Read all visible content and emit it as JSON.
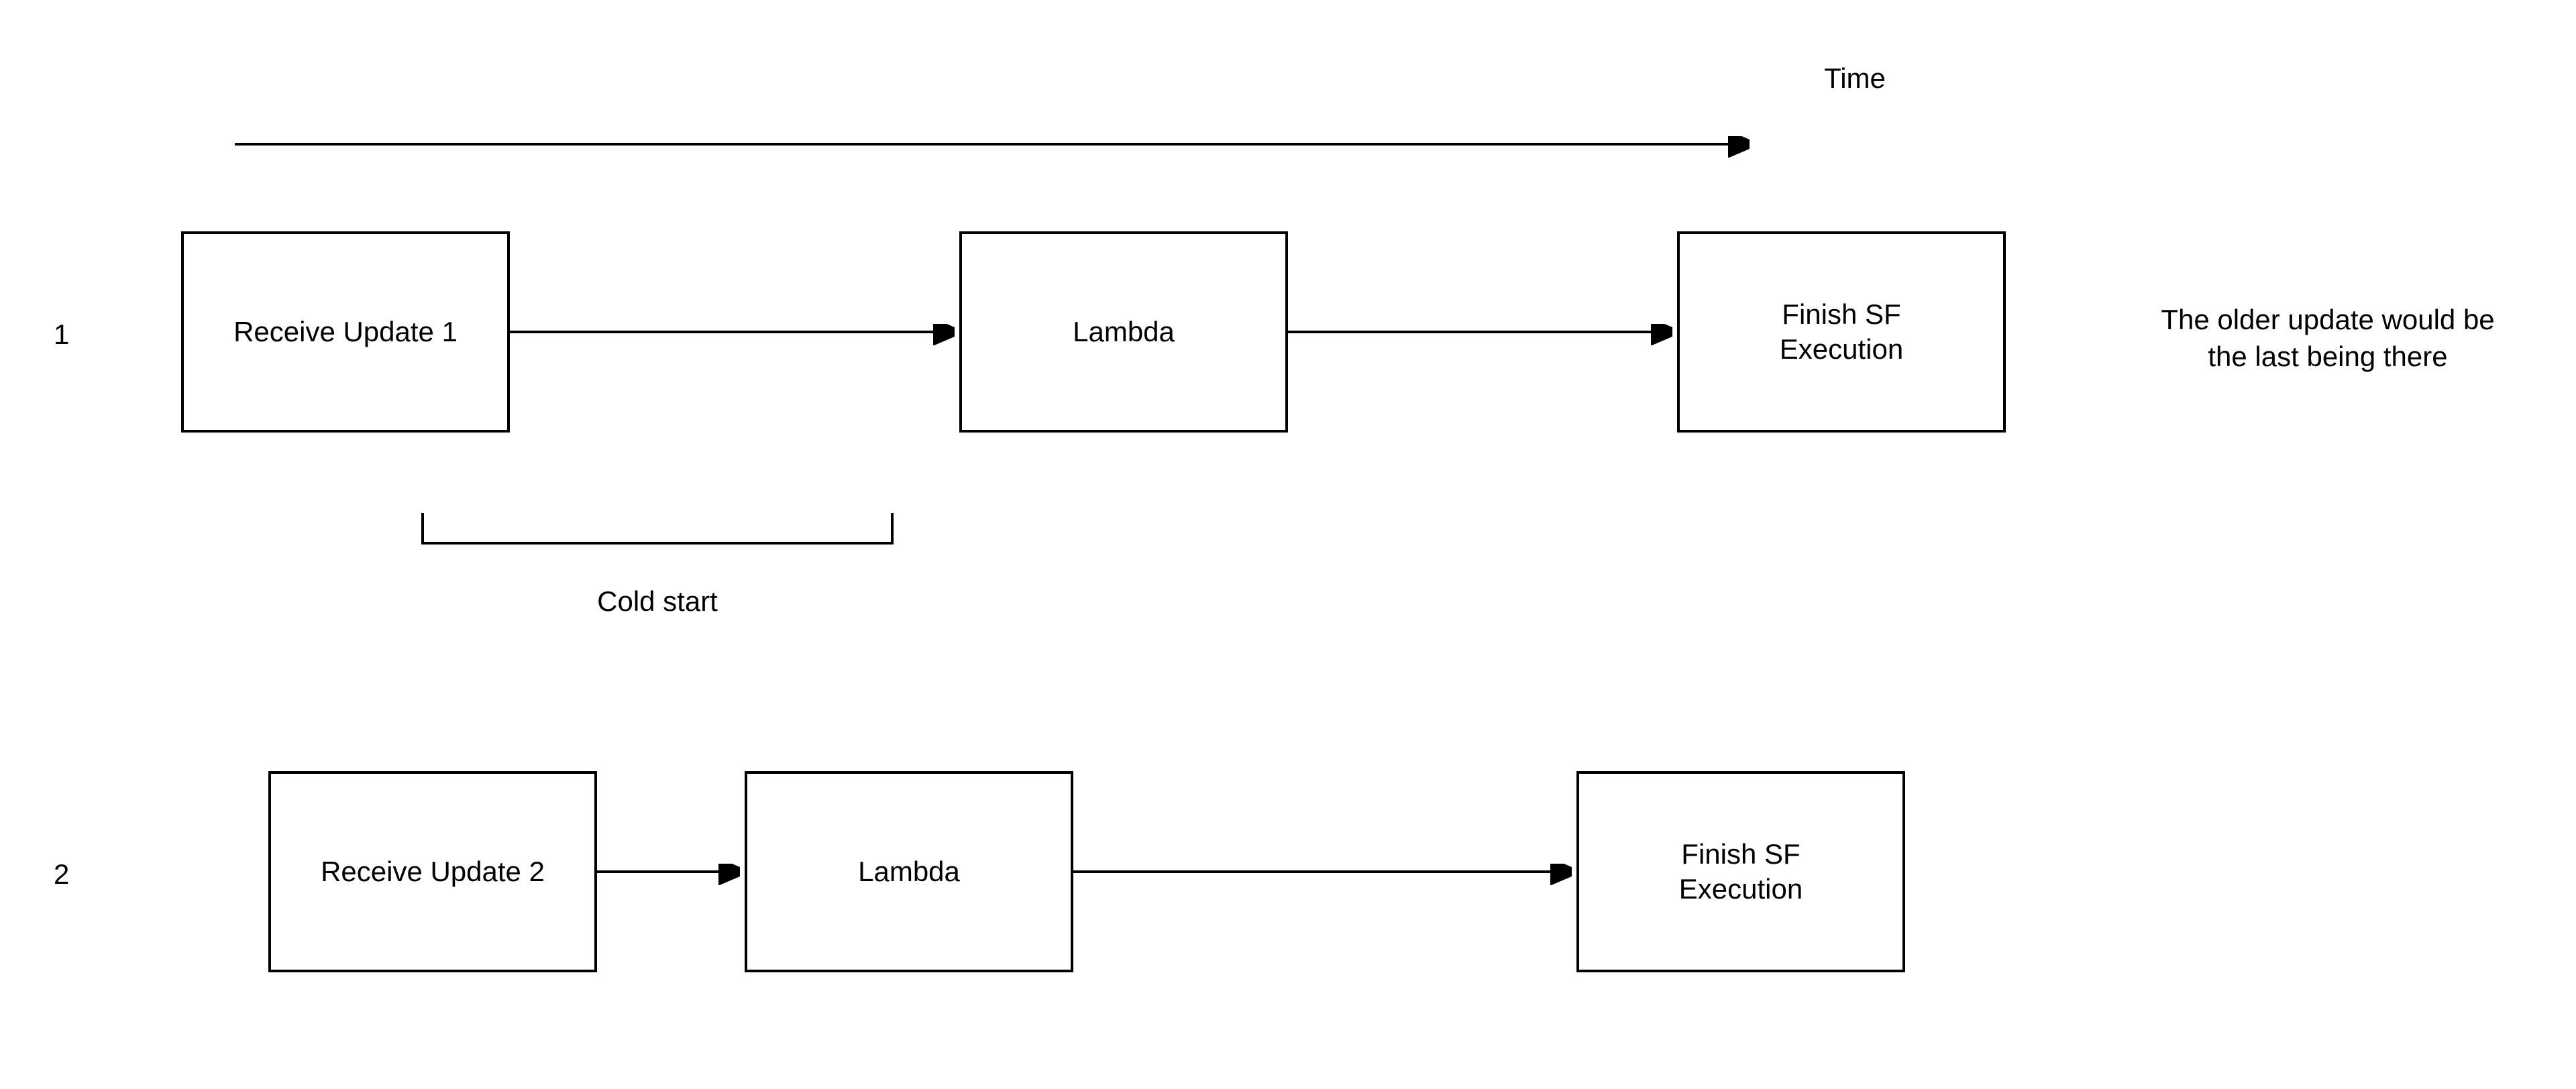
{
  "timeAxis": {
    "label": "Time"
  },
  "annotation": {
    "line1": "The older update would be",
    "line2": "the last being there"
  },
  "coldStart": {
    "label": "Cold start"
  },
  "rows": [
    {
      "num": "1",
      "boxes": {
        "receive": "Receive Update 1",
        "lambda": "Lambda",
        "finish_l1": "Finish SF",
        "finish_l2": "Execution"
      }
    },
    {
      "num": "2",
      "boxes": {
        "receive": "Receive Update 2",
        "lambda": "Lambda",
        "finish_l1": "Finish SF",
        "finish_l2": "Execution"
      }
    }
  ]
}
